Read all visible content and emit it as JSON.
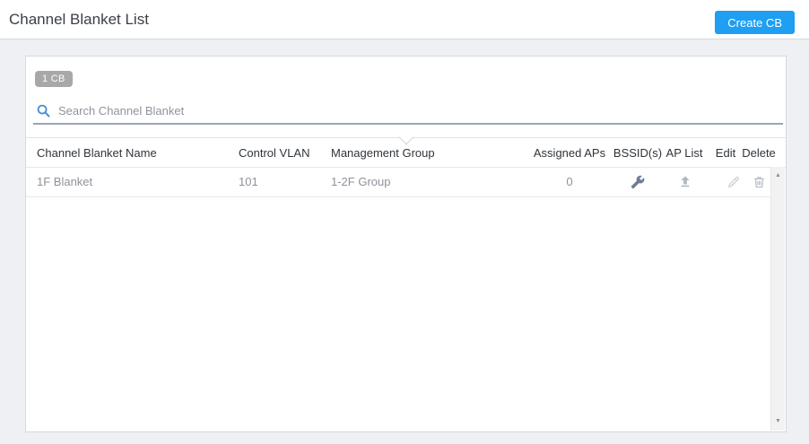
{
  "header": {
    "title": "Channel Blanket List",
    "create_button_label": "Create CB"
  },
  "panel": {
    "count_badge": "1 CB",
    "search_placeholder": "Search Channel Blanket"
  },
  "table": {
    "columns": [
      "Channel Blanket Name",
      "Control VLAN",
      "Management Group",
      "Assigned APs",
      "BSSID(s)",
      "AP List",
      "Edit",
      "Delete"
    ],
    "rows": [
      {
        "name": "1F Blanket",
        "control_vlan": "101",
        "management_group": "1-2F Group",
        "assigned_aps": "0"
      }
    ]
  },
  "icons": {
    "search": "magnifier-icon",
    "bssid": "wrench-icon",
    "ap_list": "upload-icon",
    "edit": "pencil-icon",
    "delete": "trash-icon"
  },
  "colors": {
    "accent": "#1e9ff2",
    "badge_bg": "#a8a8a8",
    "search_icon": "#4a8ed2",
    "search_underline": "#97a4bb",
    "header_text": "#2f343a",
    "row_text": "#8d929a",
    "wrench_icon": "#6e7c99",
    "muted_icon": "#b2b8c2",
    "pencil_icon": "#c6ccd4"
  }
}
